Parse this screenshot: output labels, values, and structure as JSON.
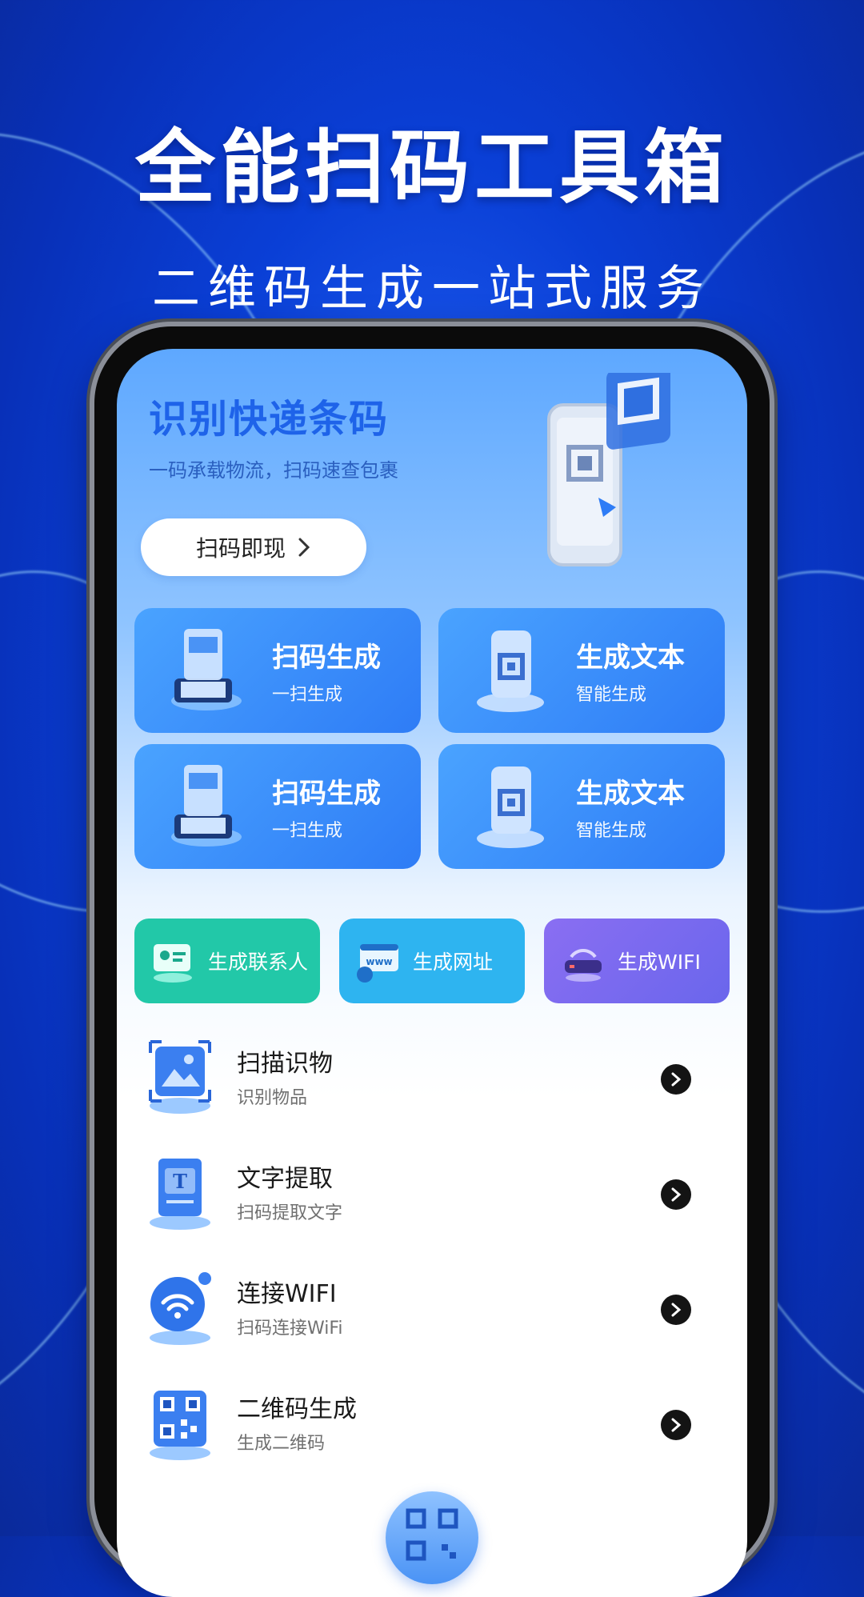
{
  "hero": {
    "title": "全能扫码工具箱",
    "subtitle": "二维码生成一站式服务"
  },
  "banner": {
    "title": "识别快递条码",
    "subtitle": "一码承载物流，扫码速查包裹",
    "button_label": "扫码即现"
  },
  "cards": [
    {
      "title": "扫码生成",
      "subtitle": "一扫生成"
    },
    {
      "title": "生成文本",
      "subtitle": "智能生成"
    },
    {
      "title": "扫码生成",
      "subtitle": "一扫生成"
    },
    {
      "title": "生成文本",
      "subtitle": "智能生成"
    }
  ],
  "mini_buttons": [
    {
      "label": "生成联系人",
      "color": "#22c8a8",
      "icon": "contact-card-icon"
    },
    {
      "label": "生成网址",
      "color": "#2eb4f0",
      "icon": "web-address-icon"
    },
    {
      "label": "生成WIFI",
      "color": "#7b6bf0",
      "icon": "wifi-router-icon"
    }
  ],
  "list": [
    {
      "title": "扫描识物",
      "subtitle": "识别物品",
      "icon": "scan-object-icon"
    },
    {
      "title": "文字提取",
      "subtitle": "扫码提取文字",
      "icon": "text-extract-icon"
    },
    {
      "title": "连接WIFI",
      "subtitle": "扫码连接WiFi",
      "icon": "wifi-connect-icon"
    },
    {
      "title": "二维码生成",
      "subtitle": "生成二维码",
      "icon": "qr-code-icon"
    }
  ],
  "colors": {
    "accent": "#1e63e9",
    "card_blue": "#2e7cf6"
  }
}
